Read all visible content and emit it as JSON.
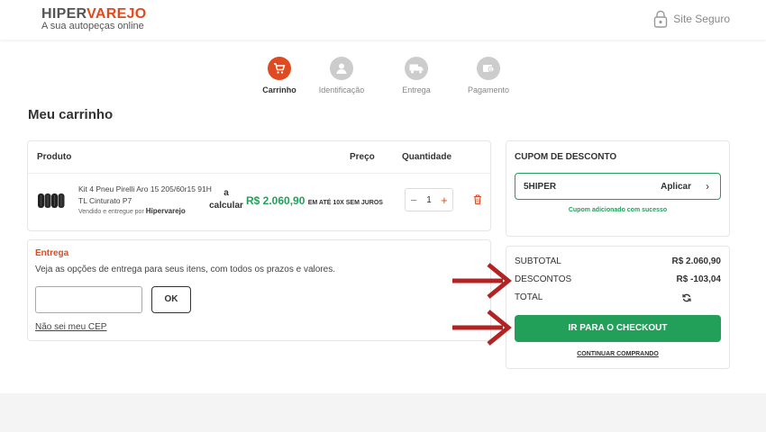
{
  "header": {
    "logo_part1": "HIPER",
    "logo_part2": "VAREJO",
    "logo_tagline": "A sua autopeças online",
    "secure_label": "Site Seguro"
  },
  "steps": [
    {
      "label": "Carrinho",
      "icon": "cart-icon",
      "active": true
    },
    {
      "label": "Identificação",
      "icon": "user-icon",
      "active": false
    },
    {
      "label": "Entrega",
      "icon": "truck-icon",
      "active": false
    },
    {
      "label": "Pagamento",
      "icon": "payment-icon",
      "active": false
    }
  ],
  "page_title": "Meu carrinho",
  "cart": {
    "col_product": "Produto",
    "col_price": "Preço",
    "col_quantity": "Quantidade",
    "item": {
      "name": "Kit 4 Pneu Pirelli Aro 15 205/60r15 91H TL Cinturato P7",
      "seller_prefix": "Vendido e entregue por",
      "seller": "Hipervarejo",
      "shipping_line1": "a",
      "shipping_line2": "calcular",
      "price": "R$ 2.060,90",
      "price_note": "EM ATÉ 10X SEM JUROS",
      "quantity": "1"
    }
  },
  "shipping": {
    "title": "Entrega",
    "description": "Veja as opções de entrega para seus itens, com todos os prazos e valores.",
    "cep_value": "",
    "ok_label": "OK",
    "unknown_cep_link": "Não sei meu CEP"
  },
  "coupon": {
    "title": "CUPOM DE DESCONTO",
    "code": "5HIPER",
    "apply_label": "Aplicar",
    "success_message": "Cupom adicionado com sucesso"
  },
  "summary": {
    "subtotal_label": "SUBTOTAL",
    "subtotal_value": "R$ 2.060,90",
    "discounts_label": "DESCONTOS",
    "discounts_value": "R$ -103,04",
    "total_label": "TOTAL",
    "checkout_label": "IR PARA O CHECKOUT",
    "continue_label": "CONTINUAR COMPRANDO"
  },
  "colors": {
    "brand_orange": "#e04a1f",
    "success_green": "#22a05a",
    "annotation_arrow": "#b22424"
  }
}
